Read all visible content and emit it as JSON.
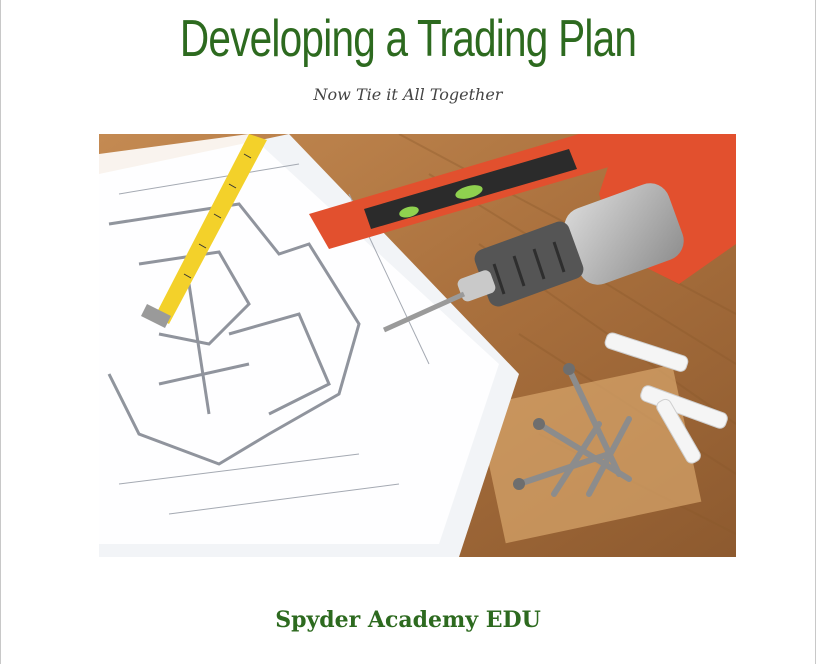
{
  "document": {
    "title": "Developing a Trading Plan",
    "subtitle": "Now Tie it All Together",
    "footer_brand": "Spyder Academy EDU"
  },
  "colors": {
    "title_green": "#2d6a1f",
    "subtitle_gray": "#444444"
  },
  "cover_image": {
    "subject": "blueprint, tape measure, level, drill and screws on wood table"
  }
}
